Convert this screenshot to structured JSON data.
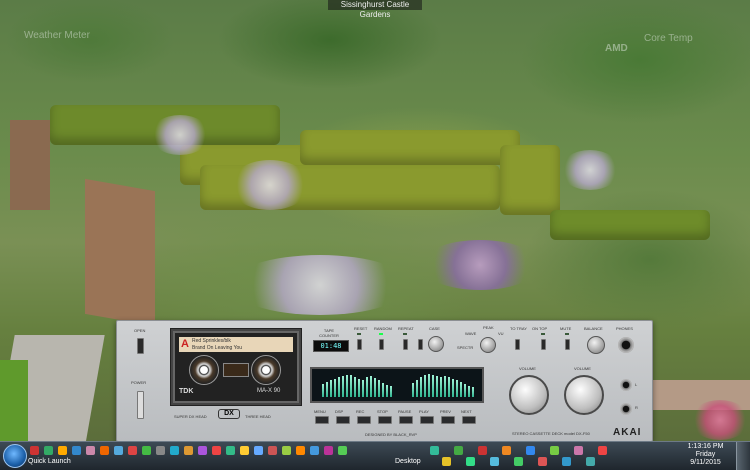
{
  "wallpaper": {
    "title": "Sissinghurst Castle Gardens"
  },
  "gadgets": {
    "weather": "Weather Meter",
    "amd": "AMD",
    "core_temp": "Core Temp"
  },
  "deck": {
    "left": {
      "open": "OPEN",
      "power": "POWER",
      "super_dx": "SUPER DX HEAD",
      "three_head": "THREE HEAD"
    },
    "cassette": {
      "letter": "A",
      "line1": "Red Sprinkles/blk",
      "line2": "Brand On Leaving You",
      "brand": "TDK",
      "type": "MA-X 90"
    },
    "controls": {
      "tape_counter": "TAPE COUNTER",
      "counter_value": "01:48",
      "reset": "RESET",
      "random": "RANDOM",
      "repeat": "REPEAT",
      "case": "CASE",
      "peak": "PEAK",
      "wave": "WAVE",
      "vu": "VU",
      "spectr": "SPECTR",
      "to_tray": "TO TRAY",
      "on_top": "ON TOP",
      "mute": "MUTE",
      "balance": "BALANCE",
      "phones": "PHONES",
      "volume_left": "VOLUME",
      "volume_right": "VOLUME"
    },
    "transport": [
      "MENU",
      "DSP",
      "REC",
      "STOP",
      "PAUSE",
      "PLAY",
      "PREV",
      "NEXT"
    ],
    "designer": "DESIGNED BY BLACK_RVP",
    "model": "STEREO CASSETTE DECK model DX-F50",
    "brand": "AKAI",
    "vu_values": [
      0.45,
      0.55,
      0.6,
      0.65,
      0.7,
      0.75,
      0.8,
      0.78,
      0.72,
      0.66,
      0.6,
      0.7,
      0.74,
      0.68,
      0.6,
      0.5,
      0.42,
      0.38,
      0.5,
      0.6,
      0.7,
      0.78,
      0.82,
      0.8,
      0.74,
      0.7,
      0.76,
      0.72,
      0.66,
      0.6,
      0.55,
      0.48,
      0.4,
      0.36
    ]
  },
  "taskbar": {
    "quick_launch": "Quick Launch",
    "desktop": "Desktop",
    "time": "1:13:16 PM",
    "day": "Friday",
    "date": "9/11/2015",
    "quick_colors": [
      "#c33",
      "#3a6",
      "#fa0",
      "#38c",
      "#c8a",
      "#e60",
      "#5ad",
      "#d44",
      "#4b4",
      "#888",
      "#2ac",
      "#d93",
      "#a5d",
      "#e44",
      "#3b8",
      "#fc3",
      "#6af",
      "#c55",
      "#9c4",
      "#f80",
      "#49d",
      "#b39",
      "#5c5"
    ],
    "tray_colors": [
      "#3b9",
      "#e6c228",
      "#4a4",
      "#3d8",
      "#c33",
      "#5bd",
      "#e82",
      "#4c6",
      "#38e",
      "#d55",
      "#7c4",
      "#39c",
      "#c7a",
      "#4aa",
      "#e44"
    ]
  }
}
